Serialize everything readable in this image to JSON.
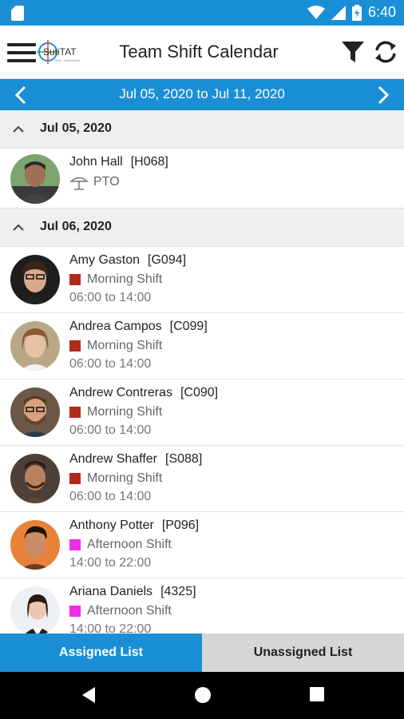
{
  "status_bar": {
    "time": "6:40"
  },
  "app_bar": {
    "title": "Team Shift Calendar",
    "logo_text": "SutiTAT",
    "logo_subtext": "Time · Attendance"
  },
  "date_range": {
    "label": "Jul 05, 2020 to Jul 11, 2020"
  },
  "groups": [
    {
      "date": "Jul 05, 2020",
      "entries": [
        {
          "name": "John Hall",
          "code": "[H068]",
          "shift": "PTO",
          "time": "",
          "type": "pto"
        }
      ]
    },
    {
      "date": "Jul 06, 2020",
      "entries": [
        {
          "name": "Amy Gaston",
          "code": "[G094]",
          "shift": "Morning Shift",
          "time": "06:00 to 14:00",
          "color": "#b22a1c"
        },
        {
          "name": "Andrea Campos",
          "code": "[C099]",
          "shift": "Morning Shift",
          "time": "06:00 to 14:00",
          "color": "#b22a1c"
        },
        {
          "name": "Andrew Contreras",
          "code": "[C090]",
          "shift": "Morning Shift",
          "time": "06:00 to 14:00",
          "color": "#b22a1c"
        },
        {
          "name": "Andrew Shaffer",
          "code": "[S088]",
          "shift": "Morning Shift",
          "time": "06:00 to 14:00",
          "color": "#b22a1c"
        },
        {
          "name": "Anthony Potter",
          "code": "[P096]",
          "shift": "Afternoon Shift",
          "time": "14:00 to 22:00",
          "color": "#ee2fe6"
        },
        {
          "name": "Ariana Daniels",
          "code": "[4325]",
          "shift": "Afternoon Shift",
          "time": "14:00 to 22:00",
          "color": "#ee2fe6"
        }
      ]
    }
  ],
  "tabs": {
    "assigned": "Assigned List",
    "unassigned": "Unassigned List"
  },
  "colors": {
    "primary": "#1a8fd6",
    "morning": "#b22a1c",
    "afternoon": "#ee2fe6"
  }
}
